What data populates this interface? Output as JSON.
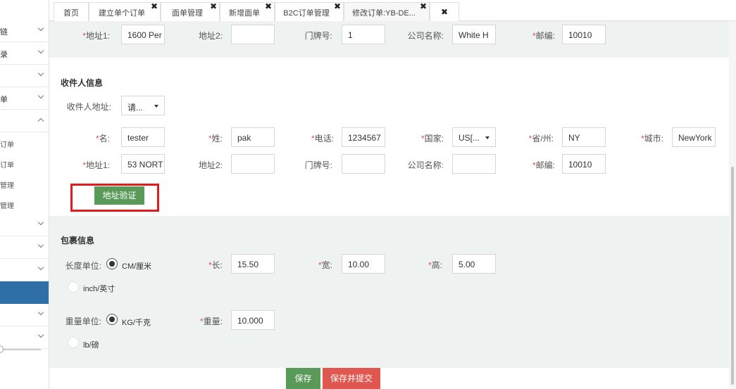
{
  "sidebar": {
    "items": [
      {
        "label": "链"
      },
      {
        "label": "录"
      },
      {
        "label": ""
      },
      {
        "label": "单"
      },
      {
        "label": ""
      }
    ],
    "subitems": [
      {
        "label": "订单"
      },
      {
        "label": "订单"
      },
      {
        "label": "管理"
      },
      {
        "label": "管理"
      }
    ],
    "lower_items": [
      {
        "label": ""
      },
      {
        "label": ""
      },
      {
        "label": ""
      },
      {
        "label": ""
      },
      {
        "label": ""
      }
    ]
  },
  "tabs": [
    {
      "label": "首页"
    },
    {
      "label": "建立单个订单"
    },
    {
      "label": "面单管理"
    },
    {
      "label": "新增面单"
    },
    {
      "label": "B2C订单管理"
    },
    {
      "label": "修改订单:YB-DE..."
    }
  ],
  "close_glyph": "✖",
  "sender_row": {
    "address1": {
      "label": "地址1:",
      "value": "1600 Per"
    },
    "address2": {
      "label": "地址2:",
      "value": ""
    },
    "door_no": {
      "label": "门牌号:",
      "value": "1"
    },
    "company": {
      "label": "公司名称:",
      "value": "White H"
    },
    "postcode": {
      "label": "邮编:",
      "value": "10010"
    }
  },
  "recipient": {
    "title": "收件人信息",
    "address_label": "收件人地址:",
    "address_select": "请...",
    "first_name": {
      "label": "名:",
      "value": "tester"
    },
    "last_name": {
      "label": "姓:",
      "value": "pak"
    },
    "phone": {
      "label": "电话:",
      "value": "1234567"
    },
    "country": {
      "label": "国家:",
      "value": "US[..."
    },
    "state": {
      "label": "省/州:",
      "value": "NY"
    },
    "city": {
      "label": "城市:",
      "value": "NewYork"
    },
    "address1": {
      "label": "地址1:",
      "value": "53 NORT"
    },
    "address2": {
      "label": "地址2:",
      "value": ""
    },
    "door_no": {
      "label": "门牌号:",
      "value": ""
    },
    "company": {
      "label": "公司名称:",
      "value": ""
    },
    "postcode": {
      "label": "邮编:",
      "value": "10010"
    },
    "verify_button": "地址验证"
  },
  "package": {
    "title": "包裹信息",
    "length_unit_label": "长度单位:",
    "length_unit_options": [
      "CM/厘米",
      "inch/英寸"
    ],
    "length": {
      "label": "长:",
      "value": "15.50"
    },
    "width": {
      "label": "宽:",
      "value": "10.00"
    },
    "height": {
      "label": "高:",
      "value": "5.00"
    },
    "weight_unit_label": "重量单位:",
    "weight_unit_options": [
      "KG/千克",
      "lb/磅"
    ],
    "weight": {
      "label": "重量:",
      "value": "10.000"
    }
  },
  "footer": {
    "save": "保存",
    "save_submit": "保存并提交"
  },
  "colors": {
    "primary_green": "#5a9a59",
    "danger_red": "#e0574f",
    "highlight_red": "#e01c1c",
    "required_star": "#d9534f"
  }
}
